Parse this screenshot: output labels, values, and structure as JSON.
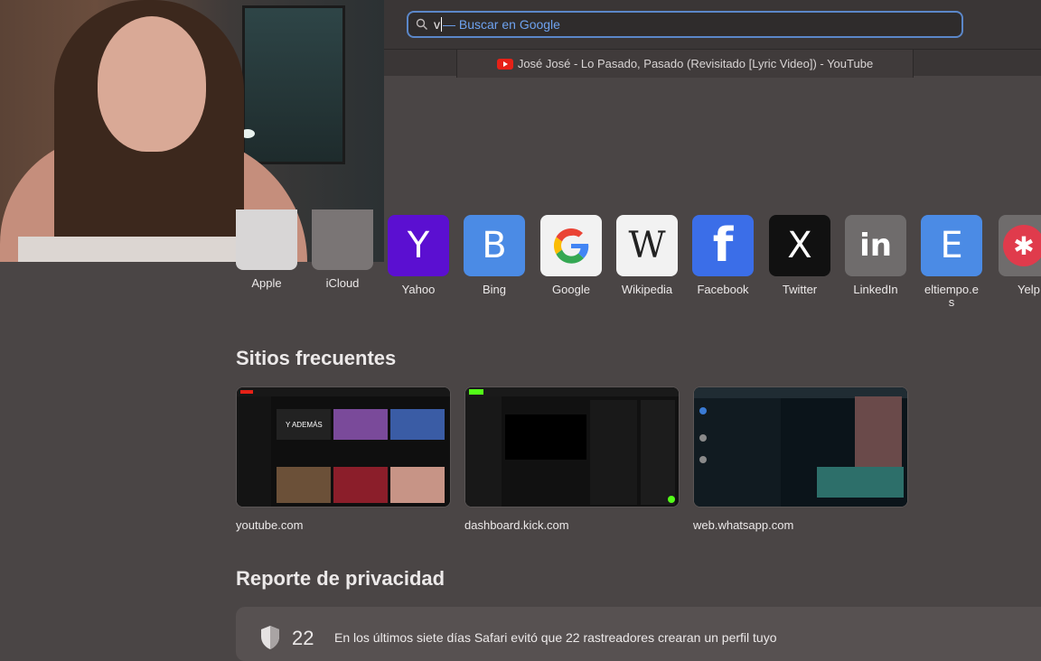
{
  "browser": {
    "address_bar": {
      "typed_text": "v",
      "suggestion_text": "— Buscar en Google"
    },
    "tab": {
      "title": "José José - Lo Pasado, Pasado (Revisitado [Lyric Video]) - YouTube",
      "favicon": "youtube-icon"
    }
  },
  "favorites": [
    {
      "label": "Apple",
      "icon": "apple-icon"
    },
    {
      "label": "iCloud",
      "icon": "icloud-icon"
    },
    {
      "label": "Yahoo",
      "letter": "Y",
      "color": "#5b0fd1"
    },
    {
      "label": "Bing",
      "letter": "B",
      "color": "#4b8be5"
    },
    {
      "label": "Google",
      "letter": "G",
      "color": "#f2f2f2"
    },
    {
      "label": "Wikipedia",
      "letter": "W",
      "color": "#f2f2f2"
    },
    {
      "label": "Facebook",
      "letter": "f",
      "color": "#3b6ee8"
    },
    {
      "label": "Twitter",
      "letter": "X",
      "color": "#111111"
    },
    {
      "label": "LinkedIn",
      "letter": "in",
      "color": "#6f6c6c"
    },
    {
      "label": "eltiempo.es",
      "letter": "E",
      "color": "#4b8be5"
    },
    {
      "label": "Yelp",
      "letter": "✱",
      "color": "#e03b4c"
    }
  ],
  "frequent": {
    "heading": "Sitios frecuentes",
    "sites": [
      {
        "label": "youtube.com"
      },
      {
        "label": "dashboard.kick.com"
      },
      {
        "label": "web.whatsapp.com"
      }
    ]
  },
  "privacy": {
    "heading": "Reporte de privacidad",
    "tracker_count": "22",
    "message": "En los últimos siete días Safari evitó que 22 rastreadores crearan un perfil tuyo"
  },
  "colors": {
    "background": "#4a4545",
    "accent": "#5b87c9",
    "suggestion": "#6ea2ef"
  }
}
